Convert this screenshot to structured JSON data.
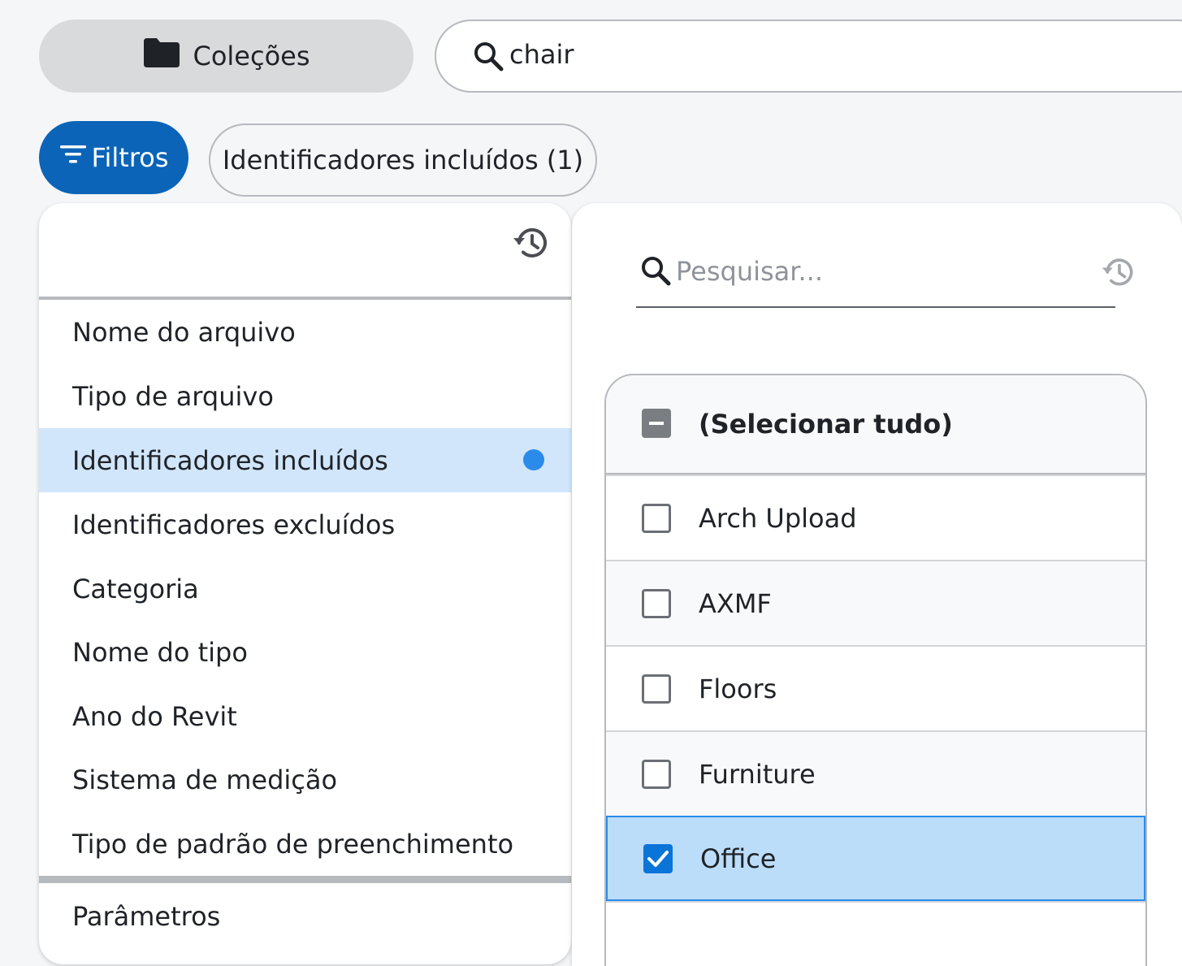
{
  "top_bar": {
    "collections_label": "Coleções",
    "collections_icon": "folder-icon",
    "search_icon": "search-icon",
    "search_value": "chair"
  },
  "filter_row": {
    "filters_label": "Filtros",
    "filters_icon": "filter-lines-icon",
    "active_chip_label": "Identificadores incluídos (1)"
  },
  "fields_panel": {
    "history_icon": "history-icon",
    "items": [
      {
        "label": "Nome do arquivo",
        "selected": false
      },
      {
        "label": "Tipo de arquivo",
        "selected": false
      },
      {
        "label": "Identificadores incluídos",
        "selected": true,
        "active_indicator": "blue-dot"
      },
      {
        "label": "Identificadores excluídos",
        "selected": false
      },
      {
        "label": "Categoria",
        "selected": false
      },
      {
        "label": "Nome do tipo",
        "selected": false
      },
      {
        "label": "Ano do Revit",
        "selected": false
      },
      {
        "label": "Sistema de medição",
        "selected": false
      },
      {
        "label": "Tipo de padrão de preenchimento",
        "selected": false
      }
    ],
    "parameters_label": "Parâmetros"
  },
  "values_panel": {
    "search_placeholder": "Pesquisar...",
    "search_value": "",
    "select_all_label": "(Selecionar tudo)",
    "select_all_state": "partial",
    "options": [
      {
        "label": "Arch Upload",
        "checked": false
      },
      {
        "label": "AXMF",
        "checked": false
      },
      {
        "label": "Floors",
        "checked": false
      },
      {
        "label": "Furniture",
        "checked": false
      },
      {
        "label": "Office",
        "checked": true
      }
    ]
  },
  "colors": {
    "accent": "#0b64b8",
    "selected_row": "#d1e6fa",
    "checked_row": "#bcddf9",
    "checkbox_checked": "#0b74d8",
    "indicator_dot": "#2b8bea"
  }
}
